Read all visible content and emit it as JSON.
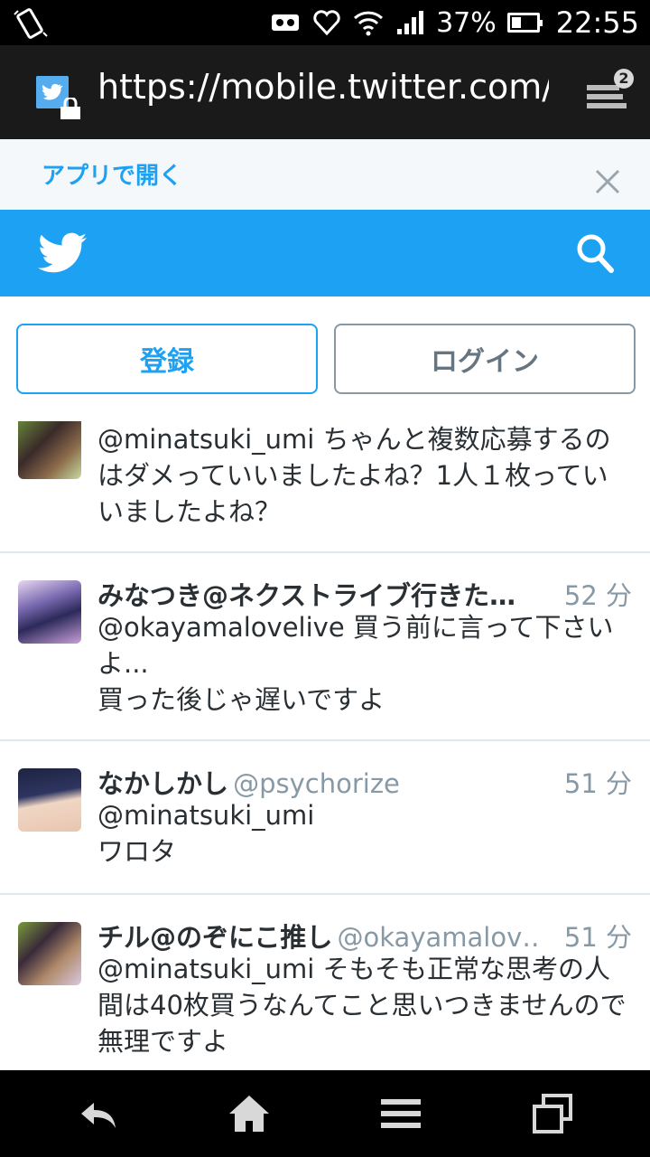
{
  "status_bar": {
    "battery_percent": "37%",
    "battery_level": 0.37,
    "time": "22:55",
    "icons": [
      "rotate-icon",
      "vr-icon",
      "heart-icon",
      "wifi-icon",
      "signal-icon",
      "battery-icon"
    ]
  },
  "browser": {
    "url": "https://mobile.twitter.com/min",
    "tab_count": "2"
  },
  "app_banner": {
    "open_app": "アプリで開く"
  },
  "actions": {
    "signup": "登録",
    "login": "ログイン"
  },
  "tweets": [
    {
      "name": "",
      "handle": "",
      "time": "",
      "text": "@minatsuki_umi ちゃんと複数応募するのはダメっていいましたよね？1人１枚っていいましたよね？"
    },
    {
      "name": "みなつき@ネクストライブ行きた…",
      "handle": "",
      "time": "52 分",
      "text_line1": "@okayamalovelive 買う前に言って下さいよ...",
      "text_line2": "買った後じゃ遅いですよ"
    },
    {
      "name": "なかしかし",
      "handle": "@psychorize",
      "time": "51 分",
      "text_line1": "@minatsuki_umi",
      "text_line2": "ワロタ"
    },
    {
      "name": "チル@のぞにこ推し",
      "handle": "@okayamalov…",
      "time": "51 分",
      "text": "@minatsuki_umi そもそも正常な思考の人間は40枚買うなんてこと思いつきませんので無理ですよ"
    }
  ],
  "colors": {
    "twitter_blue": "#1da1f2",
    "text_dark": "#292f33",
    "text_gray": "#8899a6"
  }
}
